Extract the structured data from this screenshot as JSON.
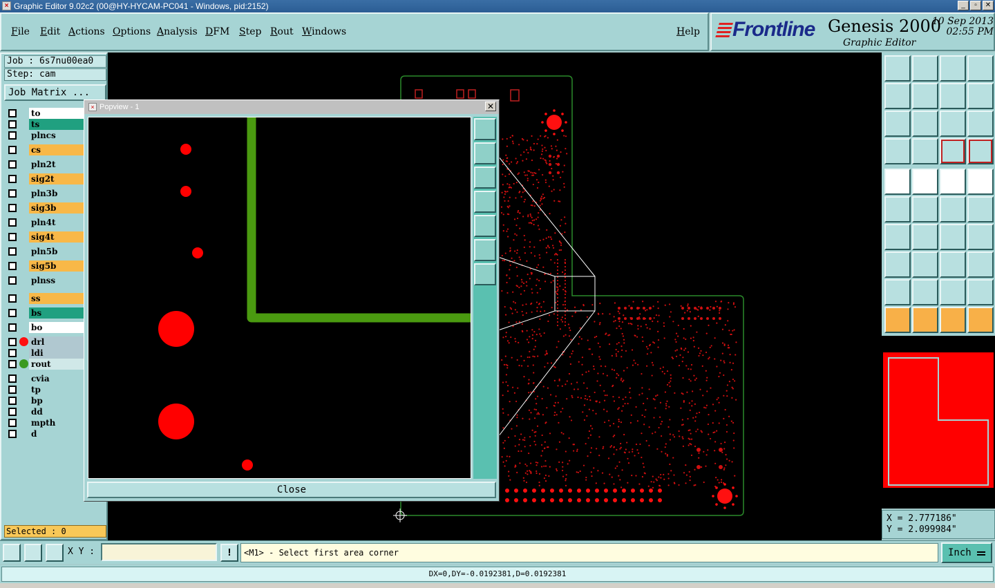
{
  "window": {
    "title": "Graphic Editor 9.02c2 (00@HY-HYCAM-PC041 - Windows, pid:2152)",
    "minimize": "_",
    "maximize": "▫",
    "close": "✕"
  },
  "menu": [
    "File",
    "Edit",
    "Actions",
    "Options",
    "Analysis",
    "DFM",
    "Step",
    "Rout",
    "Windows"
  ],
  "help": "Help",
  "brand": {
    "logo": "Frontline",
    "product": "Genesis 2000",
    "subtitle": "Graphic Editor",
    "date": "10 Sep 2013",
    "time": "02:55 PM"
  },
  "job": {
    "job_line": "Job : 6s7nu00ea0",
    "step_line": "Step: cam",
    "matrix_button": "Job Matrix ..."
  },
  "layers": [
    {
      "name": "to",
      "color": "#ffffff"
    },
    {
      "name": "ts",
      "color": "#20a080"
    },
    {
      "name": "plncs",
      "color": "#a6d4d4"
    },
    {
      "name": "cs",
      "color": "#f8b848"
    },
    {
      "name": "pln2t",
      "color": "#a6d4d4"
    },
    {
      "name": "sig2t",
      "color": "#f8b848"
    },
    {
      "name": "pln3b",
      "color": "#a6d4d4"
    },
    {
      "name": "sig3b",
      "color": "#f8b848"
    },
    {
      "name": "pln4t",
      "color": "#a6d4d4"
    },
    {
      "name": "sig4t",
      "color": "#f8b848"
    },
    {
      "name": "pln5b",
      "color": "#a6d4d4"
    },
    {
      "name": "sig5b",
      "color": "#f8b848"
    },
    {
      "name": "plnss",
      "color": "#a6d4d4"
    },
    {
      "name": "ss",
      "color": "#f8b848"
    },
    {
      "name": "bs",
      "color": "#20a080"
    },
    {
      "name": "bo",
      "color": "#ffffff"
    },
    {
      "name": "drl",
      "color": "#b0c8d0"
    },
    {
      "name": "ldi",
      "color": "#b0c8d0"
    },
    {
      "name": "rout",
      "color": "#d0e8e8"
    },
    {
      "name": "cvia",
      "color": "#a6d4d4"
    },
    {
      "name": "tp",
      "color": "#a6d4d4"
    },
    {
      "name": "bp",
      "color": "#a6d4d4"
    },
    {
      "name": "dd",
      "color": "#a6d4d4"
    },
    {
      "name": "mpth",
      "color": "#a6d4d4"
    },
    {
      "name": "d",
      "color": "#a6d4d4"
    }
  ],
  "selected": "Selected : 0",
  "popview": {
    "title": "Popview - 1",
    "close_button": "Close"
  },
  "coords": {
    "x": "X = 2.777186\"",
    "y": "Y = 2.099984\""
  },
  "bottom": {
    "xy_label": "X Y :",
    "xy_value": "",
    "bang": "!",
    "prompt": "<M1> - Select first area corner",
    "unit": "Inch"
  },
  "status": "DX=0,DY=-0.0192381,D=0.0192381",
  "colors": {
    "accent": "#a6d4d4",
    "pad": "#ff0000",
    "rout": "#4a9a10",
    "board_outline": "#2a8a2a"
  }
}
